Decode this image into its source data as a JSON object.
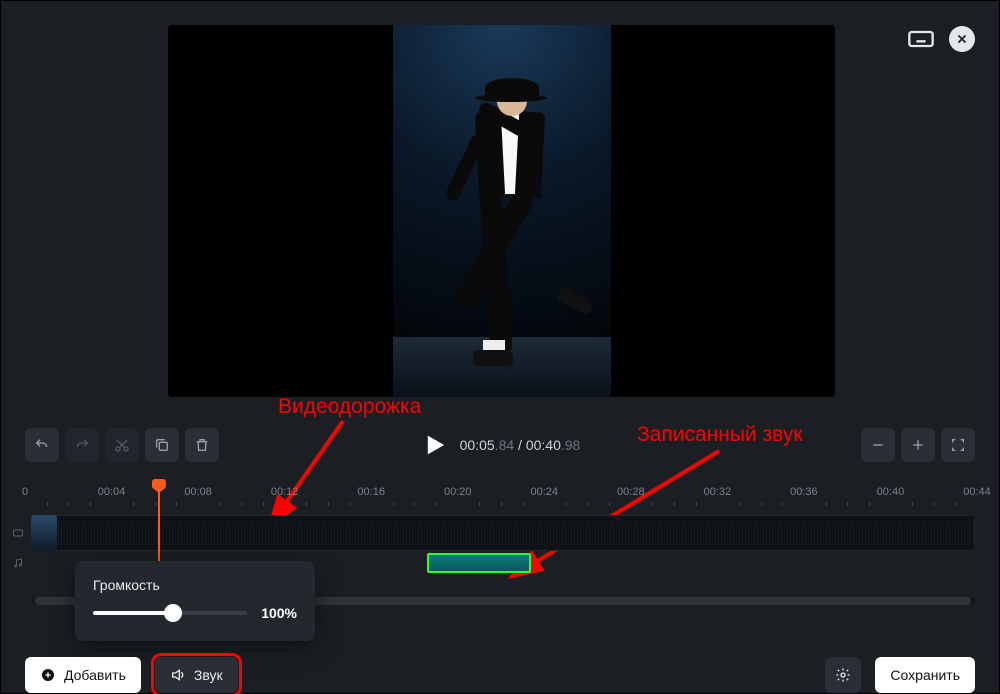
{
  "top": {
    "keyboard_alt": "keyboard",
    "close_alt": "close"
  },
  "annotations": {
    "video_track_label": "Видеодорожка",
    "recorded_audio_label": "Записанный звук"
  },
  "playback": {
    "current": "00:05",
    "current_frac": ".84",
    "sep": " / ",
    "total": "00:40",
    "total_frac": ".98"
  },
  "ruler": {
    "ticks": [
      "0",
      "00:04",
      "00:08",
      "00:12",
      "00:16",
      "00:20",
      "00:24",
      "00:28",
      "00:32",
      "00:36",
      "00:40",
      "00:44"
    ]
  },
  "timeline": {
    "playhead_pct": 13.5,
    "audio_clip": {
      "left_pct": 42,
      "width_pct": 11
    }
  },
  "popover": {
    "label": "Громкость",
    "value_pct": 52,
    "display": "100%"
  },
  "bottom": {
    "add_label": "Добавить",
    "sound_label": "Звук",
    "save_label": "Сохранить"
  }
}
